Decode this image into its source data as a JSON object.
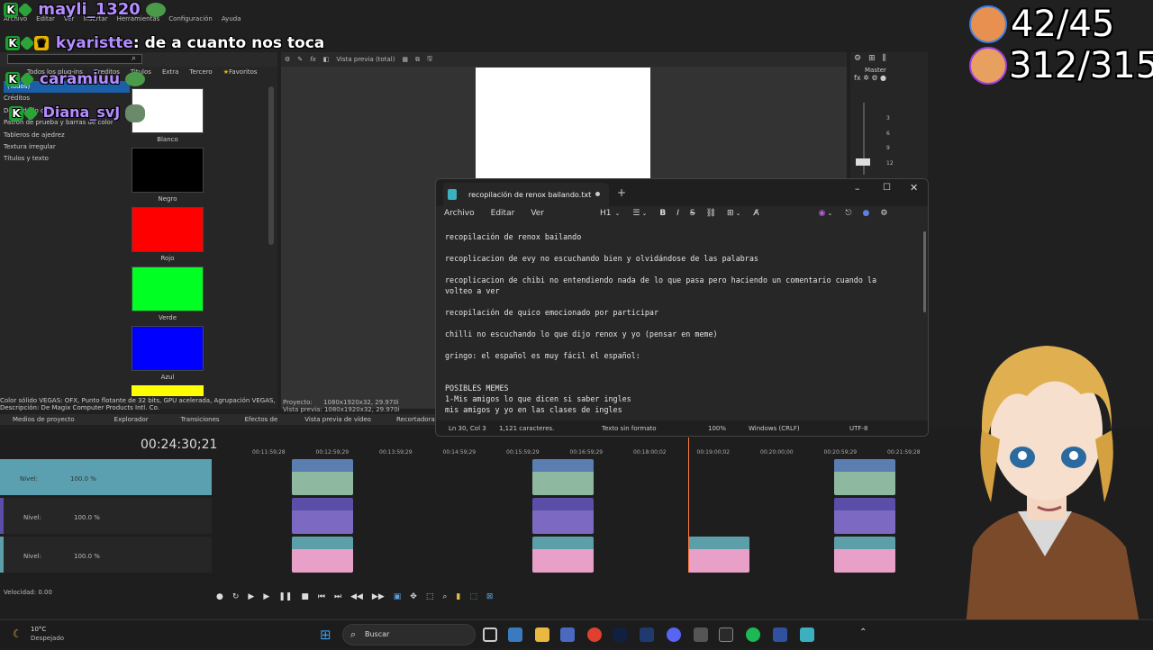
{
  "menubar": [
    "Archivo",
    "Editar",
    "Ver",
    "Insertar",
    "Herramientas",
    "Configuración",
    "Ayuda"
  ],
  "chat": [
    {
      "name": "mayli_1320",
      "message": ""
    },
    {
      "name": "kyaristte",
      "message": ": de a cuanto nos toca"
    },
    {
      "name": "caramiuu",
      "message": ""
    },
    {
      "name": "Diana_svJ",
      "message": ""
    }
  ],
  "stats": {
    "line1": "42/45",
    "line2": "312/315"
  },
  "panel_tabs": [
    "Todos los plug-ins",
    "Creditos",
    "Titulos",
    "Extra",
    "Tercero",
    "Favoritos"
  ],
  "tree": [
    "(Todos)",
    "Créditos",
    "Degradado de color",
    "Patrón de prueba y barras de color",
    "Tableros de ajedrez",
    "Textura irregular",
    "Títulos y texto"
  ],
  "swatches": [
    {
      "label": "Blanco",
      "color": "#ffffff"
    },
    {
      "label": "Negro",
      "color": "#000000"
    },
    {
      "label": "Rojo",
      "color": "#ff0000"
    },
    {
      "label": "Verde",
      "color": "#00ff22"
    },
    {
      "label": "Azul",
      "color": "#0000ff"
    },
    {
      "label": "",
      "color": "#ffff00"
    }
  ],
  "preview": {
    "mode": "Vista previa (total)",
    "proyecto_label": "Proyecto:",
    "proyecto": "1080x1920x32, 29.970i",
    "vista_label": "Vista previa:",
    "vista": "1080x1920x32, 29.970i"
  },
  "mixer": {
    "label": "Master",
    "ticks": [
      "3",
      "6",
      "9",
      "12"
    ]
  },
  "info": {
    "line1": "Color sólido VEGAS: OFX, Punto flotante de 32 bits, GPU acelerada, Agrupación VEGAS, Ve",
    "line2": "Descripción: De Magix Computer Products Intl. Co."
  },
  "bottom_tabs": [
    "Medios de proyecto",
    "Explorador",
    "Transiciones",
    "Efectos de",
    "Vista previa de vídeo",
    "Recortadora"
  ],
  "timecode": "00:24:30;21",
  "ruler": [
    "00:11:59;28",
    "00:12:59;29",
    "00:13:59;29",
    "00:14:59;29",
    "00:15:59;29",
    "00:16:59;29",
    "00:18:00;02",
    "00:19:00;02",
    "00:20:00;00",
    "00:20:59;29",
    "00:21:59;28"
  ],
  "tracks": [
    {
      "label": "Nivel:",
      "value": "100.0 %"
    },
    {
      "label": "Nivel:",
      "value": "100.0 %"
    },
    {
      "label": "Nivel:",
      "value": "100.0 %"
    }
  ],
  "speed": "Velocidad: 0.00",
  "notepad": {
    "tab_title": "recopilación de renox bailando.txt",
    "menu": [
      "Archivo",
      "Editar",
      "Ver"
    ],
    "heading": "H1",
    "lines": [
      "recopilación de renox bailando",
      "",
      "recoplicacion de evy no escuchando bien y olvidándose de las palabras",
      "",
      "recoplicacion de chibi no entendiendo nada de lo que pasa pero haciendo un comentario cuando la",
      "volteo a ver",
      "",
      "recopilación de quico emocionado por participar",
      "",
      "chilli no escuchando lo que dijo renox y yo (pensar en meme)",
      "",
      "gringo: el español es muy fácil el español:",
      "",
      "",
      "POSIBLES MEMES",
      "1-Mis amigos lo que dicen si saber ingles",
      "mis amigos y yo en las clases de ingles"
    ],
    "status": {
      "pos": "Ln 30, Col 3",
      "chars": "1,121 caracteres.",
      "format": "Texto sin formato",
      "zoom": "100%",
      "eol": "Windows (CRLF)",
      "enc": "UTF-8"
    }
  },
  "taskbar": {
    "temp": "10°C",
    "weather": "Despejado",
    "search": "Buscar"
  },
  "colors": {
    "accent": "#2ca43a",
    "chat_name": "#b48cff",
    "notepad_bg": "#272727"
  }
}
